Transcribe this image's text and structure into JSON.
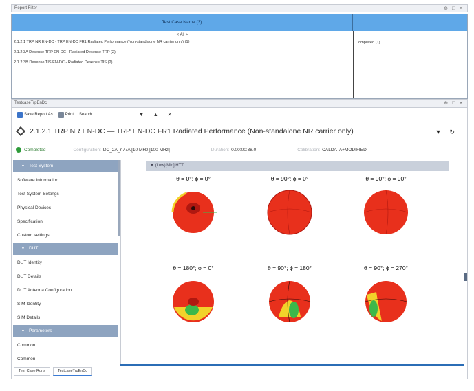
{
  "filter_panel": {
    "title": "Report Filter",
    "controls": "⊕ □ ✕",
    "column_header": "Test Case Name (3)",
    "all_label": "< All >",
    "rows": [
      "2.1.2.1 TRP NR EN-DC - TRP EN-DC FR1 Radiated Performance (Non-standalone NR carrier only) (1)",
      "2.1.2.3A Desense TRP EN-DC - Radiated Desense TRP (2)",
      "2.1.2.3B Desense TIS EN-DC - Radiated Desense TIS (2)"
    ],
    "status_value": "Completed (1)"
  },
  "main_panel": {
    "title": "TestcaseTrpEnDc",
    "controls": "⊕ □ ✕",
    "toolbar": {
      "save_label": "Save Report As",
      "print_label": "Print",
      "search_label": "Search",
      "nav_arrows": "▼ ▲ ✕"
    },
    "report_title": "2.1.2.1 TRP NR EN-DC — TRP EN-DC FR1 Radiated Performance (Non-standalone NR carrier only)",
    "status": {
      "state": "Completed",
      "config_key": "Configuration:",
      "config_value": "DC_2A_n77A [10 MHz][100 MHz]",
      "duration_key": "Duration:",
      "duration_value": "0.00:00:38.0",
      "calibration_key": "Calibration:",
      "calibration_value": "CALDATA+MODIFIED"
    }
  },
  "sidebar": {
    "groups": [
      {
        "label": "Test System",
        "items": [
          "Software Information",
          "Test System Settings",
          "Physical Devices",
          "Specification",
          "Custom settings"
        ]
      },
      {
        "label": "DUT",
        "items": [
          "DUT Identity",
          "DUT Details",
          "DUT Antenna Configuration",
          "SIM Identity",
          "SIM Details"
        ]
      },
      {
        "label": "Parameters",
        "items": [
          "Common",
          "Common"
        ]
      }
    ]
  },
  "plots": {
    "header": "(Low)[Mid] HTT",
    "cells": [
      {
        "label": "θ = 0°; ϕ = 0°",
        "variant": "top-dark"
      },
      {
        "label": "θ = 90°; ϕ = 0°",
        "variant": "red"
      },
      {
        "label": "θ = 90°; ϕ = 90°",
        "variant": "red"
      },
      {
        "label": "θ = 180°; ϕ = 0°",
        "variant": "bottom-yellow"
      },
      {
        "label": "θ = 90°; ϕ = 180°",
        "variant": "green-side"
      },
      {
        "label": "θ = 90°; ϕ = 270°",
        "variant": "green-left"
      }
    ],
    "colors": {
      "red": "#e8301c",
      "dark_red": "#b01810",
      "yellow": "#f2d22a",
      "green": "#3cb84a"
    }
  },
  "bottom_tabs": [
    "Test Case Runs",
    "TestcaseTrpEnDc"
  ]
}
